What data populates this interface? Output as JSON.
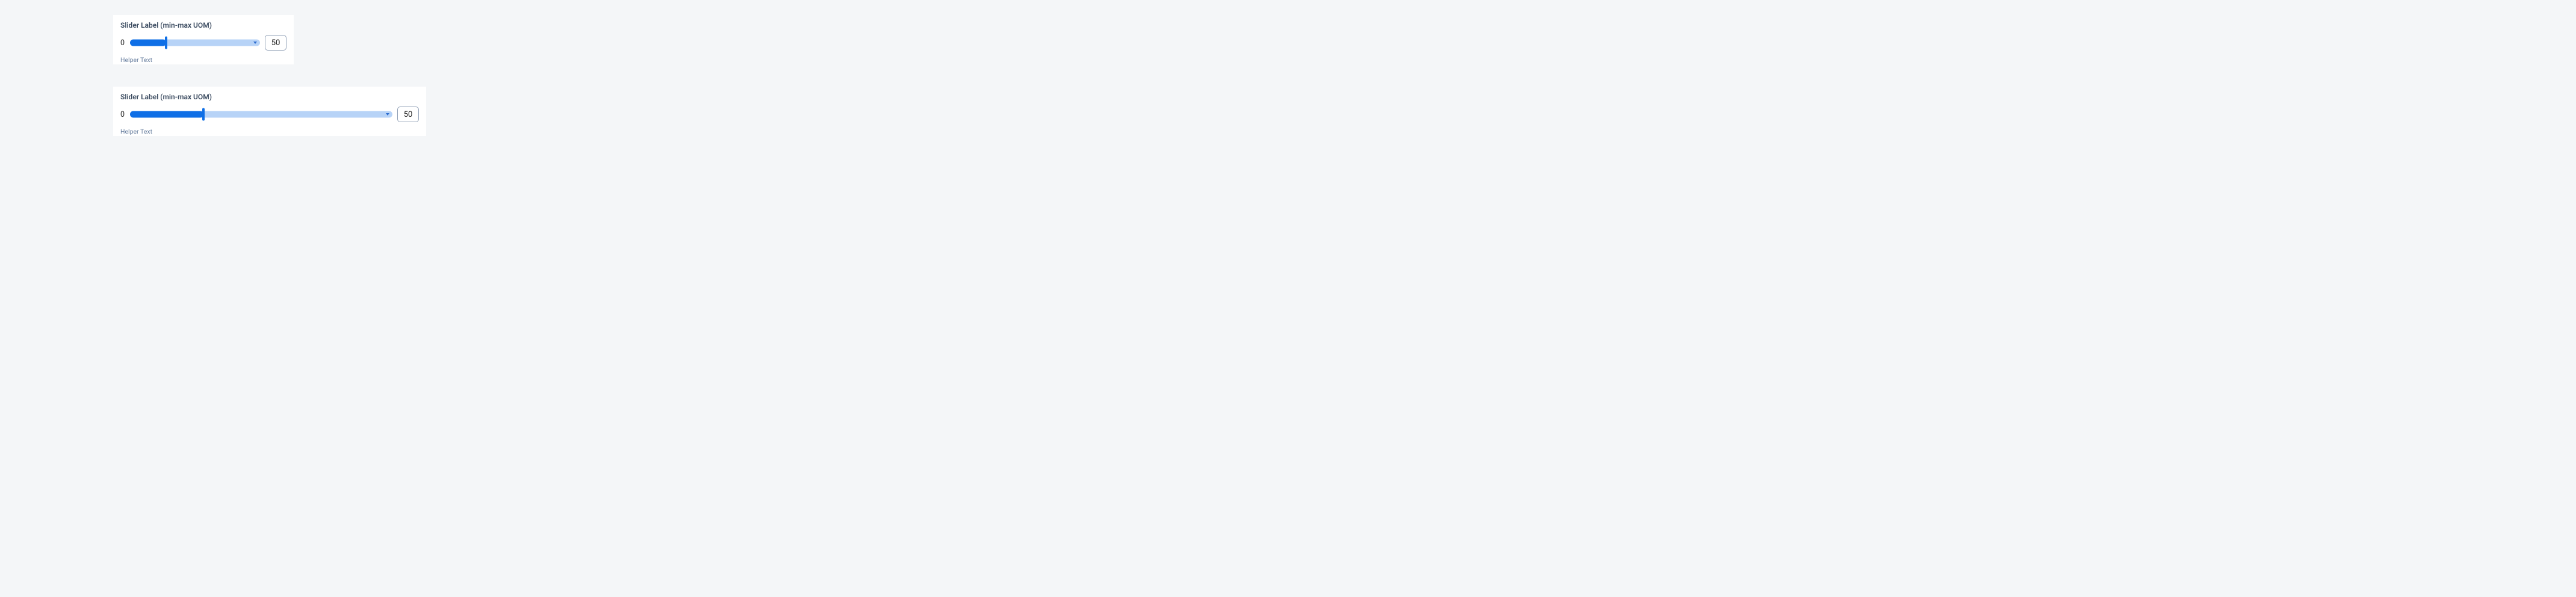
{
  "sliders": [
    {
      "label": "Slider Label (min-max UOM)",
      "min_display": "0",
      "value_display": "50",
      "helper": "Helper Text"
    },
    {
      "label": "Slider Label (min-max UOM)",
      "min_display": "0",
      "value_display": "50",
      "helper": "Helper Text"
    }
  ]
}
